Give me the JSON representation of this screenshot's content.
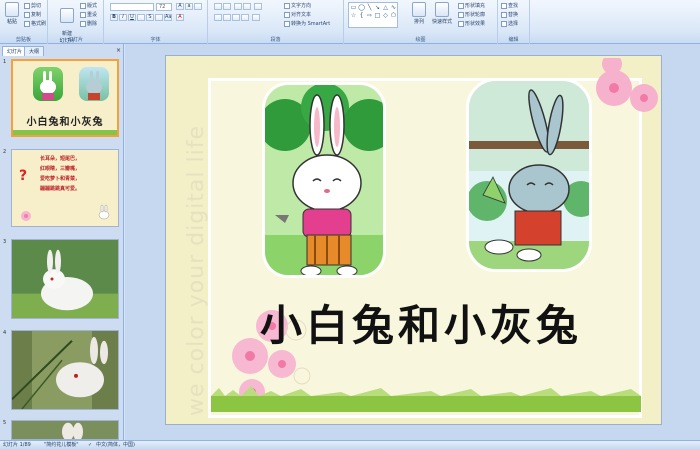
{
  "ribbon": {
    "clipboard": {
      "label": "剪贴板",
      "paste": "粘贴",
      "cut": "剪切",
      "copy": "复制",
      "format_painter": "格式刷"
    },
    "slides": {
      "label": "幻灯片",
      "new_slide": "新建\n幻灯片",
      "layout": "版式",
      "reset": "重设",
      "delete": "删除"
    },
    "font": {
      "label": "字体",
      "size": "72"
    },
    "paragraph": {
      "label": "段落",
      "text_direction": "文字方向",
      "align_text": "对齐文本",
      "smartart": "转换为 SmartArt"
    },
    "drawing": {
      "label": "绘图",
      "arrange": "排列",
      "quick_styles": "快速样式",
      "shape_fill": "形状填充",
      "shape_outline": "形状轮廓",
      "shape_effects": "形状效果"
    },
    "editing": {
      "label": "编辑",
      "find": "查找",
      "replace": "替换",
      "select": "选择"
    }
  },
  "left_pane": {
    "tabs": [
      {
        "label": "幻灯片"
      },
      {
        "label": "大纲"
      }
    ],
    "close": "×",
    "thumbs": [
      {
        "num": "1",
        "title": "小白兔和小灰兔"
      },
      {
        "num": "2",
        "lines": [
          "长耳朵，短尾巴，",
          "红眼睛，三瓣嘴，",
          "爱吃萝卜和青菜，",
          "蹦蹦跳跳真可爱。"
        ],
        "mark": "?"
      },
      {
        "num": "3"
      },
      {
        "num": "4"
      },
      {
        "num": "5"
      }
    ]
  },
  "slide": {
    "vertical_text": "we color your digital life",
    "title": "小白兔和小灰兔"
  },
  "status": {
    "slide_info": "幻灯片 1/89",
    "theme": "\"简约花儿模板\"",
    "language": "中文(简体，中国)"
  },
  "colors": {
    "accent": "#8db2e3",
    "selected_thumb": "#f2a13b",
    "slide_bg": "#f3efc7",
    "grass": "#7cbf3b"
  }
}
